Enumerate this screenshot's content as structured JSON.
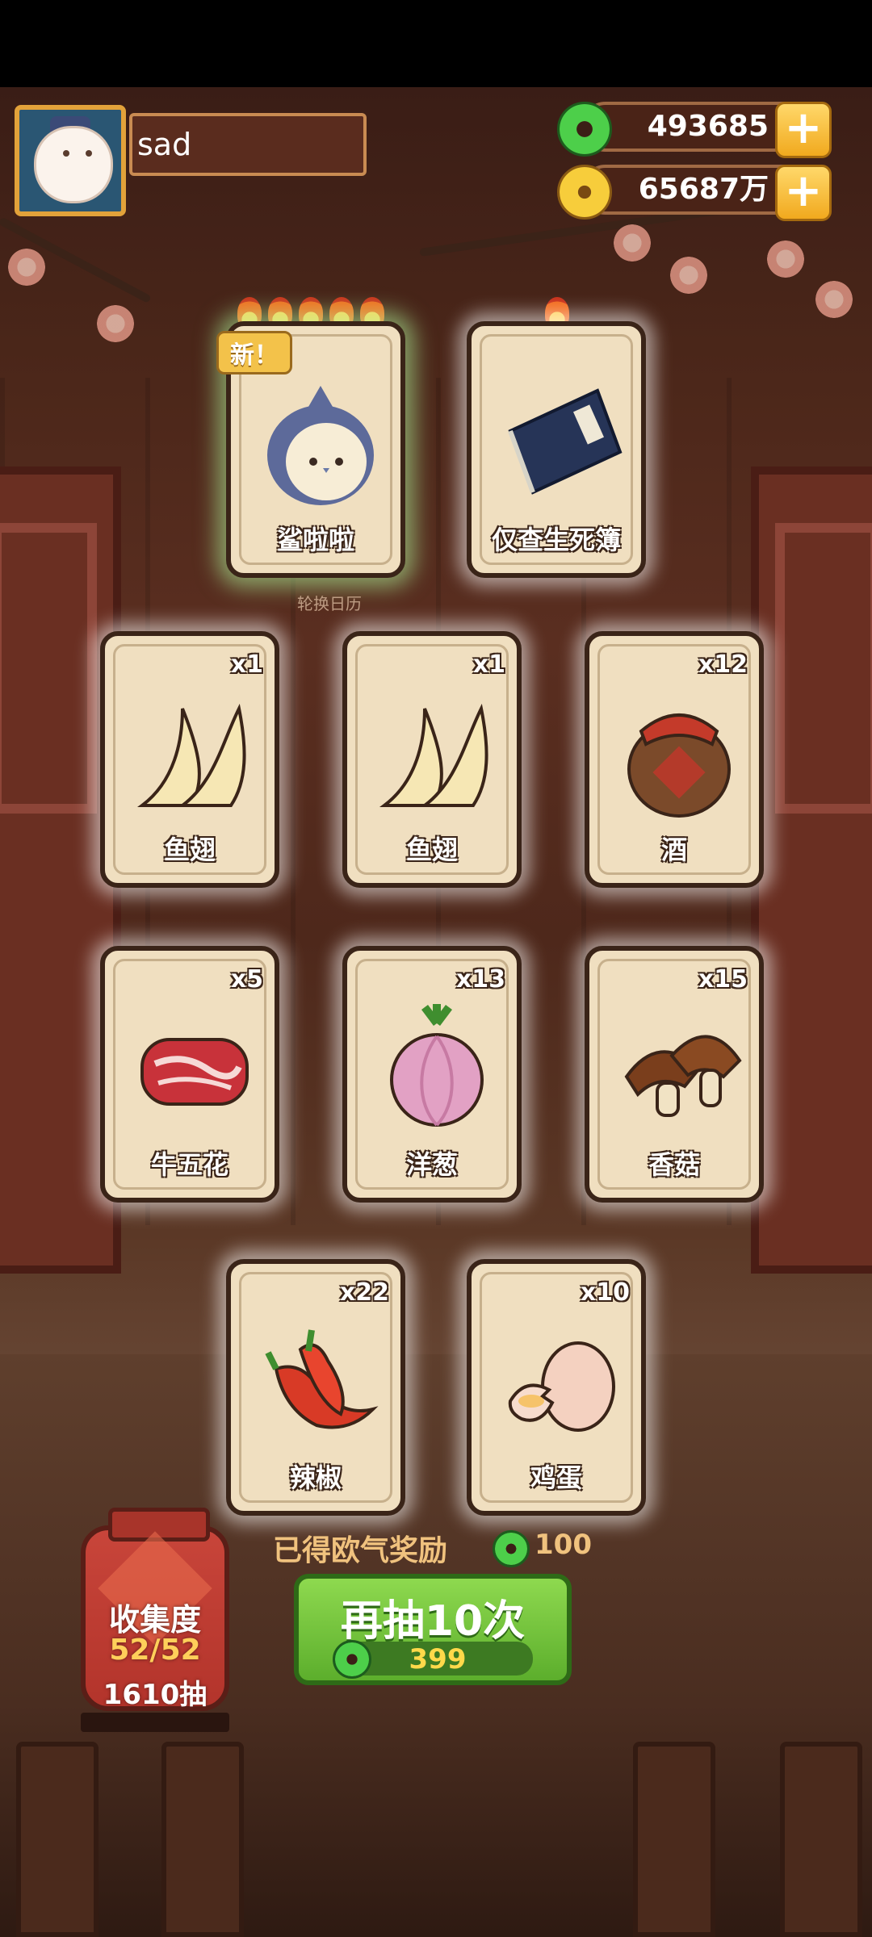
{
  "player": {
    "name": "sad"
  },
  "currencies": {
    "jade": {
      "amount": "493685"
    },
    "gold": {
      "amount": "65687万"
    }
  },
  "featured": {
    "new_tag": "新！",
    "sign_text": "轮换日历"
  },
  "cards": [
    {
      "id": "shark",
      "label": "鲨啦啦",
      "qty": "",
      "flames": 5,
      "rarity": "special",
      "icon": "shark-character-art"
    },
    {
      "id": "book",
      "label": "仅查生死簿",
      "qty": "",
      "flames": 1,
      "rarity": "rare",
      "icon": "book-art",
      "book_title": "生死簿"
    },
    {
      "id": "fin1",
      "label": "鱼翅",
      "qty": "x1",
      "icon": "fish-fin-art"
    },
    {
      "id": "fin2",
      "label": "鱼翅",
      "qty": "x1",
      "icon": "fish-fin-art"
    },
    {
      "id": "wine",
      "label": "酒",
      "qty": "x12",
      "icon": "wine-jar-art",
      "jar_text": "酒"
    },
    {
      "id": "beef",
      "label": "牛五花",
      "qty": "x5",
      "icon": "beef-art"
    },
    {
      "id": "onion",
      "label": "洋葱",
      "qty": "x13",
      "icon": "onion-art"
    },
    {
      "id": "mushroom",
      "label": "香菇",
      "qty": "x15",
      "icon": "mushroom-art"
    },
    {
      "id": "pepper",
      "label": "辣椒",
      "qty": "x22",
      "icon": "chili-pepper-art"
    },
    {
      "id": "egg",
      "label": "鸡蛋",
      "qty": "x10",
      "icon": "egg-art"
    }
  ],
  "collection": {
    "title": "收集度",
    "progress": "52/52",
    "draws": "1610抽"
  },
  "lucky": {
    "label": "已得欧气奖励",
    "amount": "100"
  },
  "draw_button": {
    "label": "再抽10次",
    "cost": "399"
  },
  "colors": {
    "accent_green": "#5cae2c",
    "card_bg": "#f0dfc0",
    "gold": "#f1a91e"
  }
}
